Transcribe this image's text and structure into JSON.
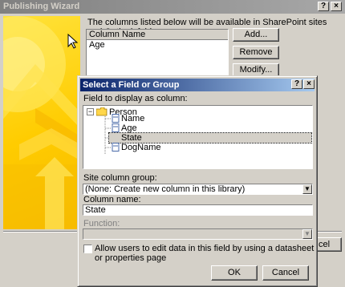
{
  "outer_window": {
    "title": "Publishing Wizard",
    "help_btn": "?",
    "close_btn": "×",
    "description": "The columns listed below will be available in SharePoint sites and Outlook folders.",
    "column_header": "Column Name",
    "columns": [
      "Age"
    ],
    "add_btn": "Add...",
    "remove_btn": "Remove",
    "modify_btn": "Modify...",
    "cancel_fragment": "cel"
  },
  "dialog": {
    "title": "Select a Field or Group",
    "help_btn": "?",
    "close_btn": "×",
    "field_label": "Field to display as column:",
    "tree": {
      "root": "Person",
      "expander": "−",
      "children": [
        "Name",
        "Age",
        "State",
        "DogName"
      ],
      "selected": "State"
    },
    "site_group_label": "Site column group:",
    "site_group_value": "(None: Create new column in this library)",
    "column_name_label": "Column name:",
    "column_name_value": "State",
    "function_label": "Function:",
    "function_value": "",
    "allow_edit_label": "Allow users to edit data in this field by using a datasheet or properties page",
    "allow_edit_checked": false,
    "ok_btn": "OK",
    "cancel_btn": "Cancel"
  },
  "colors": {
    "active_title": "#0a246a",
    "inactive_title": "#808080",
    "banner": "#ffcc00",
    "face": "#d4d0c8"
  }
}
